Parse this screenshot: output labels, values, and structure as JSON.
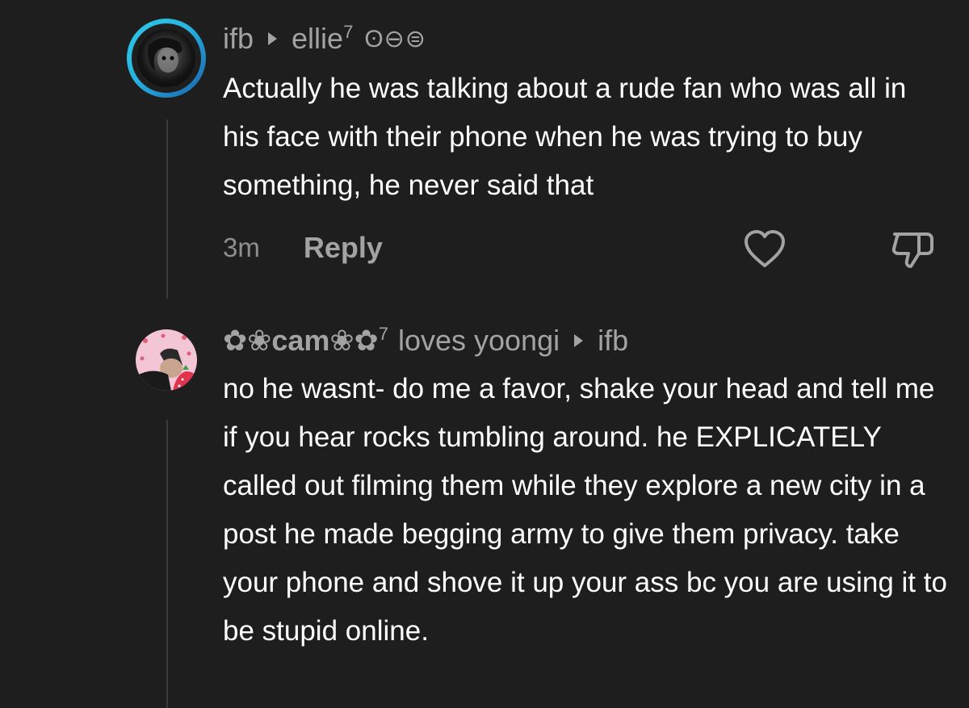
{
  "comments": [
    {
      "author": "ifb",
      "reply_to": "ellie",
      "reply_to_sup": "7",
      "reply_to_suffix": "ʘ⊖⊜",
      "text": "Actually he was talking about a rude fan who was all in his face with their phone when he was trying to buy something, he never said that",
      "time": "3m",
      "reply_label": "Reply"
    },
    {
      "author": "✿❀cam❀✿",
      "author_sup": "7",
      "author_suffix": "loves yoongi",
      "reply_to": "ifb",
      "text": "no he wasnt- do me a favor, shake your head and tell me if you hear rocks tumbling around. he EXPLICATELY called out filming them while they explore a new city in a post he made begging army to give them privacy. take your phone and shove it up your ass bc you are using it to be stupid online."
    }
  ],
  "colors": {
    "background": "#1e1e1e",
    "muted_text": "#a3a3a3",
    "ring_gradient_start": "#2ec8e6",
    "ring_gradient_end": "#1a5fa8"
  },
  "icons": [
    "heart-icon",
    "dislike-icon",
    "reply-arrow-icon"
  ]
}
